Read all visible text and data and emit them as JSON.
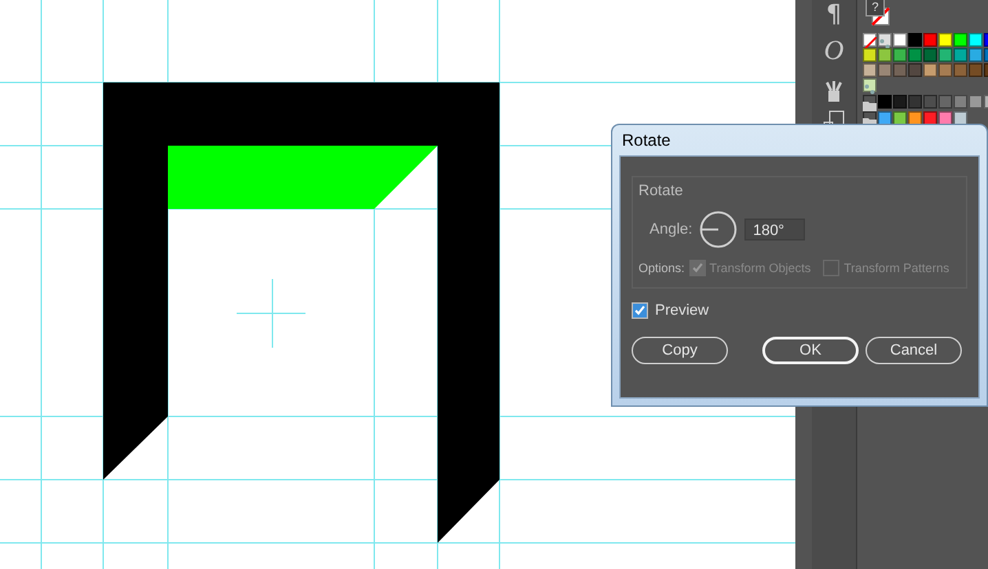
{
  "tool_glyphs": [
    "¶",
    "O"
  ],
  "fill_stroke_mark": "?",
  "swatch_rows": [
    {
      "items": [
        {
          "kind": "none",
          "color": "#ffffff"
        },
        {
          "kind": "pattern",
          "color": "#dddddd"
        },
        {
          "kind": "solid",
          "color": "#ffffff"
        },
        {
          "kind": "solid",
          "color": "#000000"
        },
        {
          "kind": "solid",
          "color": "#ff0000"
        },
        {
          "kind": "solid",
          "color": "#ffff00"
        },
        {
          "kind": "solid",
          "color": "#00ff00"
        },
        {
          "kind": "solid",
          "color": "#00ffff"
        },
        {
          "kind": "solid",
          "color": "#0000ff"
        }
      ]
    },
    {
      "items": [
        {
          "kind": "solid",
          "color": "#d4e01c"
        },
        {
          "kind": "solid",
          "color": "#8cc63f"
        },
        {
          "kind": "solid",
          "color": "#39b54a"
        },
        {
          "kind": "solid",
          "color": "#009245"
        },
        {
          "kind": "solid",
          "color": "#006837"
        },
        {
          "kind": "solid",
          "color": "#22b573"
        },
        {
          "kind": "solid",
          "color": "#00a99d"
        },
        {
          "kind": "solid",
          "color": "#29abe2"
        },
        {
          "kind": "solid",
          "color": "#0071bc"
        }
      ]
    },
    {
      "items": [
        {
          "kind": "solid",
          "color": "#c7b299"
        },
        {
          "kind": "solid",
          "color": "#998675"
        },
        {
          "kind": "solid",
          "color": "#736357"
        },
        {
          "kind": "solid",
          "color": "#534741"
        },
        {
          "kind": "solid",
          "color": "#c69c6d"
        },
        {
          "kind": "solid",
          "color": "#a67c52"
        },
        {
          "kind": "solid",
          "color": "#8c6239"
        },
        {
          "kind": "solid",
          "color": "#754c24"
        },
        {
          "kind": "solid",
          "color": "#603813"
        }
      ]
    },
    {
      "items": [
        {
          "kind": "pattern",
          "color": "#cde6b0"
        }
      ]
    },
    {
      "items": [
        {
          "kind": "folder",
          "color": "#cccccc"
        },
        {
          "kind": "solid",
          "color": "#000000"
        },
        {
          "kind": "solid",
          "color": "#1a1a1a"
        },
        {
          "kind": "solid",
          "color": "#333333"
        },
        {
          "kind": "solid",
          "color": "#4d4d4d"
        },
        {
          "kind": "solid",
          "color": "#666666"
        },
        {
          "kind": "solid",
          "color": "#808080"
        },
        {
          "kind": "solid",
          "color": "#999999"
        },
        {
          "kind": "solid",
          "color": "#b3b3b3"
        }
      ]
    },
    {
      "items": [
        {
          "kind": "folder",
          "color": "#cccccc"
        },
        {
          "kind": "solid",
          "color": "#3fa9f5"
        },
        {
          "kind": "solid",
          "color": "#7ac943"
        },
        {
          "kind": "solid",
          "color": "#ff931e"
        },
        {
          "kind": "solid",
          "color": "#ff1d25"
        },
        {
          "kind": "solid",
          "color": "#ff7bac"
        },
        {
          "kind": "solid",
          "color": "#bdccd4"
        }
      ]
    }
  ],
  "dialog": {
    "title": "Rotate",
    "group_title": "Rotate",
    "angle_label": "Angle:",
    "angle_value": "180°",
    "options_label": "Options:",
    "options": [
      {
        "label": "Transform Objects",
        "checked": true,
        "disabled": true
      },
      {
        "label": "Transform Patterns",
        "checked": false,
        "disabled": true
      }
    ],
    "preview": {
      "label": "Preview",
      "checked": true
    },
    "buttons": [
      {
        "label": "Copy",
        "default": false
      },
      {
        "label": "OK",
        "default": true
      },
      {
        "label": "Cancel",
        "default": false
      }
    ]
  }
}
